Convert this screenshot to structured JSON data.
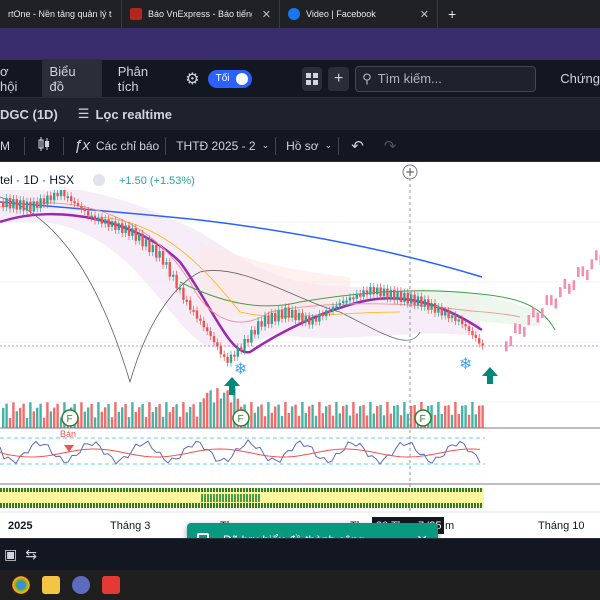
{
  "browser_tabs": [
    {
      "label": "rtOne - Nền tảng quản lý t",
      "favicon_color": "#7b5cd6"
    },
    {
      "label": "Báo VnExpress - Báo tiếng Việt",
      "favicon_color": "#b3261e"
    },
    {
      "label": "Video | Facebook",
      "favicon_color": "#1877f2"
    }
  ],
  "toolbar": {
    "partial_left": "ơ hội",
    "chart_select": "Biểu đồ",
    "analysis": "Phân tích",
    "toggle_label": "Tối",
    "search_placeholder": "Tìm kiếm...",
    "partial_right": "Chứng"
  },
  "symbol_bar": {
    "symbol": "DGC (1D)",
    "filter": "Lọc realtime"
  },
  "chart_toolbar": {
    "interval": "M",
    "indicators": "Các chỉ báo",
    "template": "THTĐ 2025 - 2",
    "profile": "Hồ sơ"
  },
  "legend": {
    "name": "tel · 1D · HSX",
    "change": "+1.50 (+1.53%)"
  },
  "chart_data": {
    "type": "candlestick",
    "x_tick_labels": [
      "2025",
      "Tháng 3",
      "Tháng 10"
    ],
    "marker_label": "F",
    "sell_label": "Bán",
    "overlapped_labels": [
      "Th",
      "Th",
      "20 Th",
      "7 '25",
      "m"
    ]
  },
  "colors": {
    "up": "#26a69a",
    "down": "#ef5350",
    "ma_purple": "#9c27b0",
    "ma_blue": "#2962ff",
    "toast": "#089981"
  },
  "toast": {
    "message": "Đã lưu biểu đồ thành công"
  }
}
